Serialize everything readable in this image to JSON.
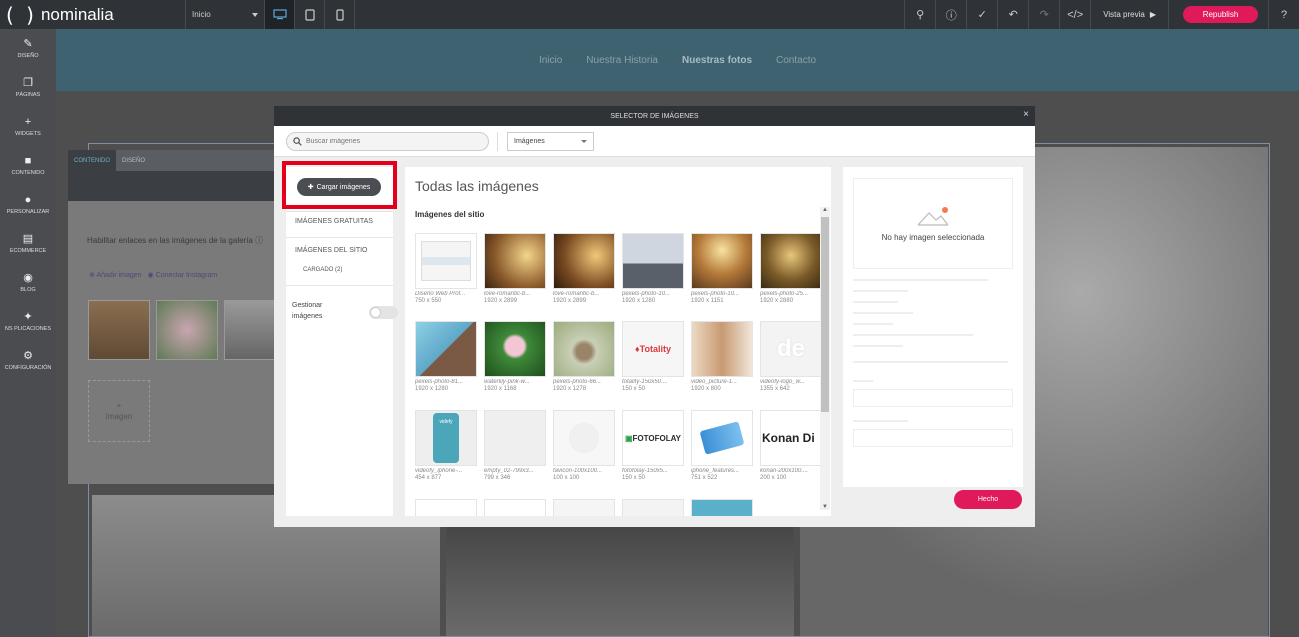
{
  "app": {
    "logo_text": "nominalia",
    "logo_paren": "( )",
    "page_select": "Inicio",
    "preview_label": "Vista previa",
    "republish_label": "Republish"
  },
  "sidebar": {
    "items": [
      {
        "label": "Diseño",
        "icon": "pencil-icon"
      },
      {
        "label": "Páginas",
        "icon": "pages-icon"
      },
      {
        "label": "Widgets",
        "icon": "plus-icon"
      },
      {
        "label": "Contenido",
        "icon": "folder-icon"
      },
      {
        "label": "Personalizar",
        "icon": "person-icon"
      },
      {
        "label": "Ecommerce",
        "icon": "cart-icon"
      },
      {
        "label": "Blog",
        "icon": "chat-icon"
      },
      {
        "label": "NS PLICACIONES",
        "icon": "puzzle-icon"
      },
      {
        "label": "Configuración",
        "icon": "gear-icon"
      }
    ]
  },
  "site": {
    "nav": [
      "Inicio",
      "Nuestra Historia",
      "Nuestras fotos",
      "Contacto"
    ],
    "nav_active": "Nuestras fotos"
  },
  "gallery_panel": {
    "tabs": [
      "Contenido",
      "Diseño"
    ],
    "enable_links_label": "Habilitar enlaces en las imágenes de la galería",
    "add_image_link": "Añadir imagen",
    "connect_instagram_link": "Conectar Instagram",
    "add_tile_plus": "+",
    "add_tile_label": "Imagen"
  },
  "modal": {
    "title": "Selector de imágenes",
    "close": "×",
    "search_placeholder": "Buscar imágenes",
    "filter_value": "Imágenes",
    "upload_label": "Cargar imágenes",
    "free_images": "Imágenes gratuitas",
    "site_images": "Imágenes del sitio",
    "uploaded": "Cargado (2)",
    "manage_label": "Gestionar imágenes",
    "heading": "Todas las imágenes",
    "subheading": "Imágenes del sitio",
    "no_selection": "No hay imagen seleccionada",
    "done_label": "Hecho",
    "images": [
      {
        "name": "Diseño Web Prof...",
        "size": "750 x 550"
      },
      {
        "name": "love-romantic-b...",
        "size": "1920 x 2899"
      },
      {
        "name": "love-romantic-b...",
        "size": "1920 x 2899"
      },
      {
        "name": "pexels-photo-10...",
        "size": "1920 x 1280"
      },
      {
        "name": "pexels-photo-10...",
        "size": "1920 x 1151"
      },
      {
        "name": "pexels-photo-25...",
        "size": "1920 x 2880"
      },
      {
        "name": "pexels-photo-81...",
        "size": "1920 x 1280"
      },
      {
        "name": "waterlily-pink-w...",
        "size": "1920 x 1168"
      },
      {
        "name": "pexels-photo-66...",
        "size": "1920 x 1278"
      },
      {
        "name": "totality-150x50....",
        "size": "150 x 50"
      },
      {
        "name": "video_picture-1...",
        "size": "1920 x 800"
      },
      {
        "name": "videofy-logo_w...",
        "size": "1355 x 642"
      },
      {
        "name": "videofy_iphone-...",
        "size": "454 x 877"
      },
      {
        "name": "empty_02-799x3...",
        "size": "799 x 346"
      },
      {
        "name": "favicon-100x100...",
        "size": "100 x 100"
      },
      {
        "name": "fotofolay-150x5...",
        "size": "150 x 50"
      },
      {
        "name": "iphone_features...",
        "size": "751 x 522"
      },
      {
        "name": "konan-200x100....",
        "size": "200 x 100"
      }
    ],
    "logo_texts": {
      "totality": "Totality",
      "fotofolay": "FOTOFOLAY",
      "konan": "Konan Di",
      "videofy_mark": "de",
      "videofy_small": "videfy"
    }
  },
  "colors": {
    "accent": "#e0195a",
    "topbar": "#2f3338",
    "highlight": "#e3001b"
  }
}
